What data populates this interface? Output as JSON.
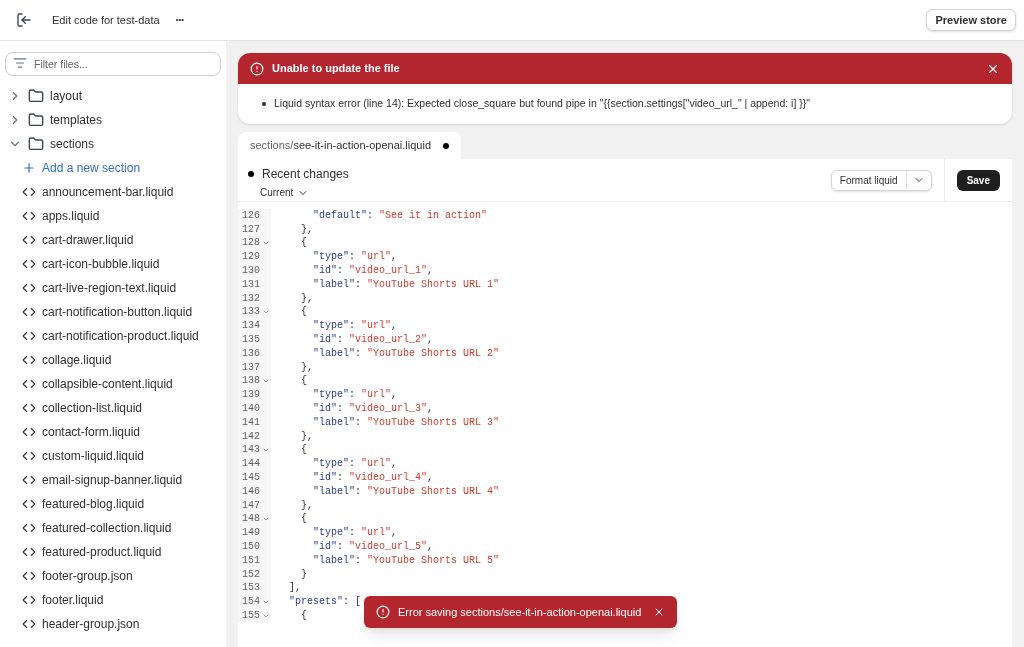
{
  "header": {
    "title": "Edit code for test-data",
    "more": "•••",
    "preview_button": "Preview store"
  },
  "sidebar": {
    "filter": {
      "placeholder": "Filter files..."
    },
    "folders": [
      {
        "name": "layout",
        "expanded": false
      },
      {
        "name": "templates",
        "expanded": false
      },
      {
        "name": "sections",
        "expanded": true,
        "children": [
          {
            "kind": "action",
            "name": "Add a new section"
          },
          {
            "kind": "file",
            "name": "announcement-bar.liquid"
          },
          {
            "kind": "file",
            "name": "apps.liquid"
          },
          {
            "kind": "file",
            "name": "cart-drawer.liquid"
          },
          {
            "kind": "file",
            "name": "cart-icon-bubble.liquid"
          },
          {
            "kind": "file",
            "name": "cart-live-region-text.liquid"
          },
          {
            "kind": "file",
            "name": "cart-notification-button.liquid"
          },
          {
            "kind": "file",
            "name": "cart-notification-product.liquid"
          },
          {
            "kind": "file",
            "name": "collage.liquid"
          },
          {
            "kind": "file",
            "name": "collapsible-content.liquid"
          },
          {
            "kind": "file",
            "name": "collection-list.liquid"
          },
          {
            "kind": "file",
            "name": "contact-form.liquid"
          },
          {
            "kind": "file",
            "name": "custom-liquid.liquid"
          },
          {
            "kind": "file",
            "name": "email-signup-banner.liquid"
          },
          {
            "kind": "file",
            "name": "featured-blog.liquid"
          },
          {
            "kind": "file",
            "name": "featured-collection.liquid"
          },
          {
            "kind": "file",
            "name": "featured-product.liquid"
          },
          {
            "kind": "file",
            "name": "footer-group.json"
          },
          {
            "kind": "file",
            "name": "footer.liquid"
          },
          {
            "kind": "file",
            "name": "header-group.json"
          }
        ]
      }
    ]
  },
  "error_banner": {
    "title": "Unable to update the file",
    "message": "Liquid syntax error (line 14): Expected close_square but found pipe in \"{{section.settings[\"video_url_\" | append: i] }}\""
  },
  "tab": {
    "folder": "sections/",
    "file": "see-it-in-action-openai.liquid",
    "unsaved": true
  },
  "toolbar": {
    "recent_changes": "Recent changes",
    "version": "Current",
    "format_button": "Format liquid",
    "save_button": "Save"
  },
  "code_lines": [
    {
      "number": "126",
      "foldable": false,
      "tokens": [
        {
          "kind": "key",
          "text": "      \"default\""
        },
        {
          "kind": "plain",
          "text": ": "
        },
        {
          "kind": "string",
          "text": "\"See it in action\""
        }
      ]
    },
    {
      "number": "127",
      "foldable": false,
      "tokens": [
        {
          "kind": "plain",
          "text": "    },"
        }
      ]
    },
    {
      "number": "128",
      "foldable": true,
      "tokens": [
        {
          "kind": "plain",
          "text": "    {"
        }
      ]
    },
    {
      "number": "129",
      "foldable": false,
      "tokens": [
        {
          "kind": "key",
          "text": "      \"type\""
        },
        {
          "kind": "plain",
          "text": ": "
        },
        {
          "kind": "string",
          "text": "\"url\""
        },
        {
          "kind": "plain",
          "text": ","
        }
      ]
    },
    {
      "number": "130",
      "foldable": false,
      "tokens": [
        {
          "kind": "key",
          "text": "      \"id\""
        },
        {
          "kind": "plain",
          "text": ": "
        },
        {
          "kind": "string",
          "text": "\"video_url_1\""
        },
        {
          "kind": "plain",
          "text": ","
        }
      ]
    },
    {
      "number": "131",
      "foldable": false,
      "tokens": [
        {
          "kind": "key",
          "text": "      \"label\""
        },
        {
          "kind": "plain",
          "text": ": "
        },
        {
          "kind": "string",
          "text": "\"YouTube Shorts URL 1\""
        }
      ]
    },
    {
      "number": "132",
      "foldable": false,
      "tokens": [
        {
          "kind": "plain",
          "text": "    },"
        }
      ]
    },
    {
      "number": "133",
      "foldable": true,
      "tokens": [
        {
          "kind": "plain",
          "text": "    {"
        }
      ]
    },
    {
      "number": "134",
      "foldable": false,
      "tokens": [
        {
          "kind": "key",
          "text": "      \"type\""
        },
        {
          "kind": "plain",
          "text": ": "
        },
        {
          "kind": "string",
          "text": "\"url\""
        },
        {
          "kind": "plain",
          "text": ","
        }
      ]
    },
    {
      "number": "135",
      "foldable": false,
      "tokens": [
        {
          "kind": "key",
          "text": "      \"id\""
        },
        {
          "kind": "plain",
          "text": ": "
        },
        {
          "kind": "string",
          "text": "\"video_url_2\""
        },
        {
          "kind": "plain",
          "text": ","
        }
      ]
    },
    {
      "number": "136",
      "foldable": false,
      "tokens": [
        {
          "kind": "key",
          "text": "      \"label\""
        },
        {
          "kind": "plain",
          "text": ": "
        },
        {
          "kind": "string",
          "text": "\"YouTube Shorts URL 2\""
        }
      ]
    },
    {
      "number": "137",
      "foldable": false,
      "tokens": [
        {
          "kind": "plain",
          "text": "    },"
        }
      ]
    },
    {
      "number": "138",
      "foldable": true,
      "tokens": [
        {
          "kind": "plain",
          "text": "    {"
        }
      ]
    },
    {
      "number": "139",
      "foldable": false,
      "tokens": [
        {
          "kind": "key",
          "text": "      \"type\""
        },
        {
          "kind": "plain",
          "text": ": "
        },
        {
          "kind": "string",
          "text": "\"url\""
        },
        {
          "kind": "plain",
          "text": ","
        }
      ]
    },
    {
      "number": "140",
      "foldable": false,
      "tokens": [
        {
          "kind": "key",
          "text": "      \"id\""
        },
        {
          "kind": "plain",
          "text": ": "
        },
        {
          "kind": "string",
          "text": "\"video_url_3\""
        },
        {
          "kind": "plain",
          "text": ","
        }
      ]
    },
    {
      "number": "141",
      "foldable": false,
      "tokens": [
        {
          "kind": "key",
          "text": "      \"label\""
        },
        {
          "kind": "plain",
          "text": ": "
        },
        {
          "kind": "string",
          "text": "\"YouTube Shorts URL 3\""
        }
      ]
    },
    {
      "number": "142",
      "foldable": false,
      "tokens": [
        {
          "kind": "plain",
          "text": "    },"
        }
      ]
    },
    {
      "number": "143",
      "foldable": true,
      "tokens": [
        {
          "kind": "plain",
          "text": "    {"
        }
      ]
    },
    {
      "number": "144",
      "foldable": false,
      "tokens": [
        {
          "kind": "key",
          "text": "      \"type\""
        },
        {
          "kind": "plain",
          "text": ": "
        },
        {
          "kind": "string",
          "text": "\"url\""
        },
        {
          "kind": "plain",
          "text": ","
        }
      ]
    },
    {
      "number": "145",
      "foldable": false,
      "tokens": [
        {
          "kind": "key",
          "text": "      \"id\""
        },
        {
          "kind": "plain",
          "text": ": "
        },
        {
          "kind": "string",
          "text": "\"video_url_4\""
        },
        {
          "kind": "plain",
          "text": ","
        }
      ]
    },
    {
      "number": "146",
      "foldable": false,
      "tokens": [
        {
          "kind": "key",
          "text": "      \"label\""
        },
        {
          "kind": "plain",
          "text": ": "
        },
        {
          "kind": "string",
          "text": "\"YouTube Shorts URL 4\""
        }
      ]
    },
    {
      "number": "147",
      "foldable": false,
      "tokens": [
        {
          "kind": "plain",
          "text": "    },"
        }
      ]
    },
    {
      "number": "148",
      "foldable": true,
      "tokens": [
        {
          "kind": "plain",
          "text": "    {"
        }
      ]
    },
    {
      "number": "149",
      "foldable": false,
      "tokens": [
        {
          "kind": "key",
          "text": "      \"type\""
        },
        {
          "kind": "plain",
          "text": ": "
        },
        {
          "kind": "string",
          "text": "\"url\""
        },
        {
          "kind": "plain",
          "text": ","
        }
      ]
    },
    {
      "number": "150",
      "foldable": false,
      "tokens": [
        {
          "kind": "key",
          "text": "      \"id\""
        },
        {
          "kind": "plain",
          "text": ": "
        },
        {
          "kind": "string",
          "text": "\"video_url_5\""
        },
        {
          "kind": "plain",
          "text": ","
        }
      ]
    },
    {
      "number": "151",
      "foldable": false,
      "tokens": [
        {
          "kind": "key",
          "text": "      \"label\""
        },
        {
          "kind": "plain",
          "text": ": "
        },
        {
          "kind": "string",
          "text": "\"YouTube Shorts URL 5\""
        }
      ]
    },
    {
      "number": "152",
      "foldable": false,
      "tokens": [
        {
          "kind": "plain",
          "text": "    }"
        }
      ]
    },
    {
      "number": "153",
      "foldable": false,
      "tokens": [
        {
          "kind": "plain",
          "text": "  ],"
        }
      ]
    },
    {
      "number": "154",
      "foldable": true,
      "tokens": [
        {
          "kind": "key",
          "text": "  \"presets\""
        },
        {
          "kind": "plain",
          "text": ": ["
        }
      ]
    },
    {
      "number": "155",
      "foldable": true,
      "tokens": [
        {
          "kind": "plain",
          "text": "    {"
        }
      ]
    }
  ],
  "toast": {
    "message": "Error saving sections/see-it-in-action-openai.liquid"
  }
}
